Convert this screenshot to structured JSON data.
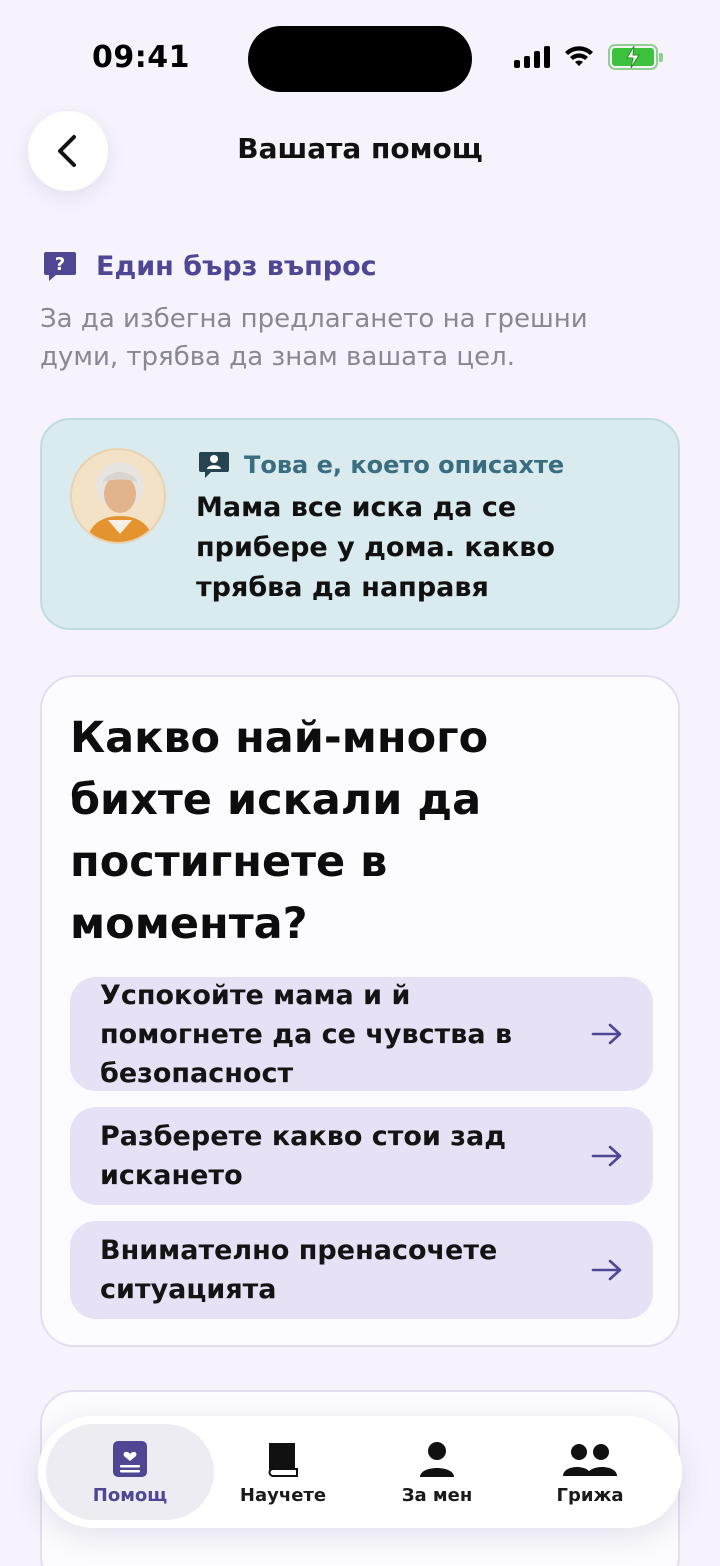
{
  "status_bar": {
    "time": "09:41",
    "icons": [
      "signal-icon",
      "wifi-icon",
      "battery-charging-icon"
    ]
  },
  "header": {
    "title": "Вашата помощ",
    "back_icon": "chevron-left-icon"
  },
  "quick_question": {
    "icon": "question-bubble-icon",
    "label": "Един бърз въпрос",
    "subtitle": "За да избегна предлагането на грешни думи, трябва да знам вашата цел."
  },
  "described": {
    "icon": "person-bubble-icon",
    "label": "Това е, което описахте",
    "text": "Мама все иска да се прибере у дома. какво трябва да направя"
  },
  "question": {
    "title": "Какво най-много бихте искали да постигнете в момента?",
    "options": [
      {
        "label": "Успокойте мама и й помогнете да се чувства в безопасност"
      },
      {
        "label": "Разберете какво стои зад искането"
      },
      {
        "label": "Внимателно пренасочете ситуацията"
      }
    ]
  },
  "bottom_nav": {
    "items": [
      {
        "label": "Помощ",
        "icon": "help-card-icon",
        "active": true
      },
      {
        "label": "Научете",
        "icon": "book-icon",
        "active": false
      },
      {
        "label": "За мен",
        "icon": "person-icon",
        "active": false
      },
      {
        "label": "Грижа",
        "icon": "people-icon",
        "active": false
      }
    ]
  },
  "colors": {
    "background": "#f6f3fc",
    "accent": "#4f4694",
    "described_card": "#d9ebee",
    "option_bg": "#e7e1f6"
  }
}
